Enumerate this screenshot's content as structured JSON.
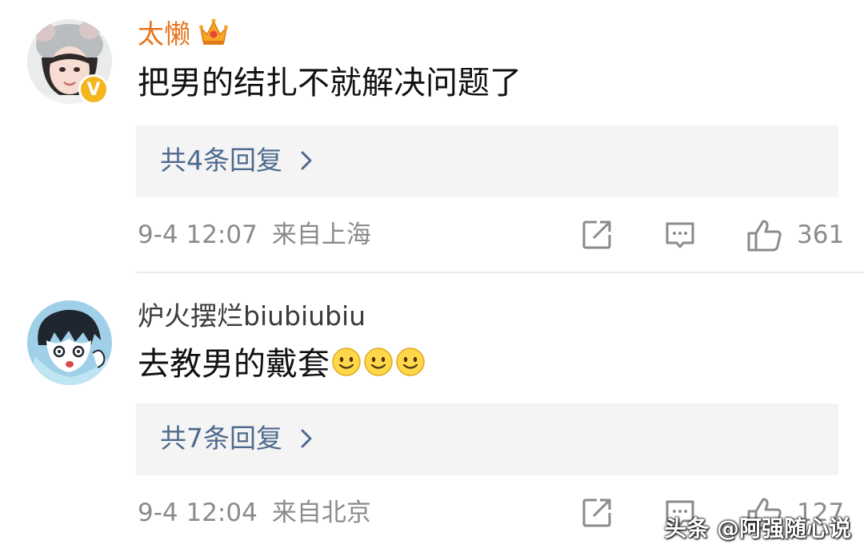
{
  "comments": [
    {
      "username": "太懒",
      "text": "把男的结扎不就解决问题了",
      "reply_label": "共4条回复",
      "time": "9-4 12:07",
      "location": "来自上海",
      "likes": "361",
      "verified": "V",
      "username_color": "#e8741c"
    },
    {
      "username": "炉火摆烂biubiubiu",
      "text": "去教男的戴套",
      "reply_label": "共7条回复",
      "time": "9-4 12:04",
      "location": "来自北京",
      "likes": "127",
      "username_color": "#3a3a3a"
    }
  ],
  "watermark": "头条 @阿强随心说",
  "colors": {
    "reply_link": "#4e6a8e",
    "meta": "#8b8b8b",
    "reply_bg": "#f4f4f4"
  }
}
